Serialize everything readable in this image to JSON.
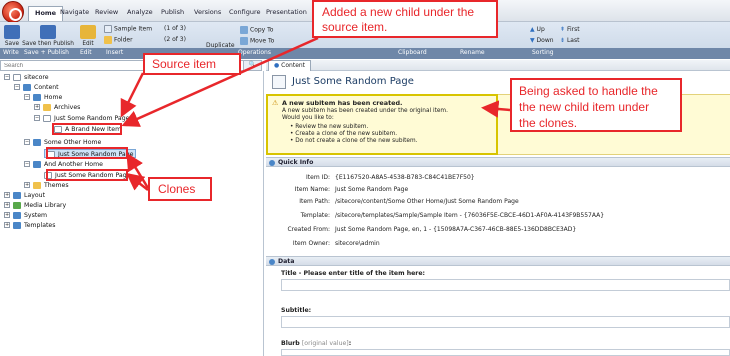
{
  "tabs": [
    "Home",
    "Navigate",
    "Review",
    "Analyze",
    "Publish",
    "Versions",
    "Configure",
    "Presentation"
  ],
  "ribbon": {
    "save": "Save",
    "save_publish": "Save then Publish",
    "edit": "Edit",
    "sample_item": "Sample Item",
    "sample_count": "(1 of 3)",
    "folder": "Folder",
    "folder_count": "(2 of 3)",
    "duplicate": "Duplicate",
    "copy_to": "Copy To",
    "move_to": "Move To",
    "up": "Up",
    "down": "Down",
    "first": "First",
    "last": "Last",
    "groups": [
      "Write",
      "Save + Publish",
      "Edit",
      "Insert",
      "Operations",
      "Clipboard",
      "Rename",
      "Sorting"
    ]
  },
  "search": {
    "placeholder": "Search"
  },
  "tree": {
    "sitecore": "sitecore",
    "content": "Content",
    "home": "Home",
    "archives": "Archives",
    "page1": "Just Some Random Page",
    "child": "A Brand New Item",
    "other_home": "Some Other Home",
    "page2": "Just Some Random Page",
    "another_home": "And Another Home",
    "page3": "Just Some Random Page",
    "themes": "Themes",
    "layout": "Layout",
    "media": "Media Library",
    "system": "System",
    "templates": "Templates"
  },
  "content": {
    "tab": "Content",
    "title": "Just Some Random Page",
    "warning": {
      "title": "A new subitem has been created.",
      "line1": "A new subitem has been created under the original item.",
      "line2": "Would you like to:",
      "b1": "Review the new subitem.",
      "b2": "Create a clone of the new subitem.",
      "b3": "Do not create a clone of the new subitem."
    },
    "quickinfo": {
      "heading": "Quick Info",
      "item_id_label": "Item ID:",
      "item_id": "{E1167520-A8A5-4538-B783-C84C41BE7F50}",
      "item_name_label": "Item Name:",
      "item_name": "Just Some Random Page",
      "item_path_label": "Item Path:",
      "item_path": "/sitecore/content/Some Other Home/Just Some Random Page",
      "template_label": "Template:",
      "template": "/sitecore/templates/Sample/Sample Item - {76036F5E-CBCE-46D1-AF0A-4143F9B557AA}",
      "created_from_label": "Created From:",
      "created_from": "Just Some Random Page, en, 1 - {15098A7A-C367-46CB-88E5-136DD8BCE3AD}",
      "owner_label": "Item Owner:",
      "owner": "sitecore\\admin"
    },
    "data": {
      "heading": "Data",
      "title_field": "Title - Please enter title of the item here:",
      "subtitle_field": "Subtitle:",
      "blurb_field": "Blurb",
      "blurb_note": "[original value]",
      "blurb_colon": ":"
    }
  },
  "annotations": {
    "new_child": [
      "Added a new child under the",
      "source item."
    ],
    "source": "Source item",
    "handle": [
      "Being asked to handle the",
      "the new child item under",
      "the clones."
    ],
    "clones": "Clones",
    "color": "#e8272b"
  }
}
